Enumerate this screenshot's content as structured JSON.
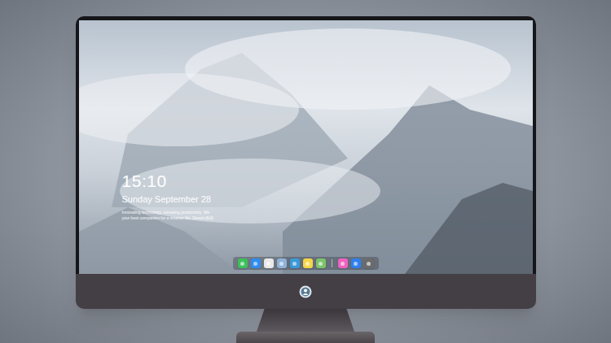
{
  "lock_screen": {
    "time": "15:10",
    "date": "Sunday September 28",
    "tagline": [
      "Innovating technology, elevating productivity. We",
      "your best companion for a smarter life. Deepin系统"
    ]
  },
  "dock": {
    "items": [
      {
        "kind": "app",
        "color": "#3cc15a"
      },
      {
        "kind": "app",
        "color": "#2f8df0"
      },
      {
        "kind": "app",
        "color": "#e9e9e9"
      },
      {
        "kind": "app",
        "color": "#8fb3d9"
      },
      {
        "kind": "app",
        "color": "#3a9ad9"
      },
      {
        "kind": "app",
        "color": "#f5d547"
      },
      {
        "kind": "app",
        "color": "#7cc36b"
      },
      {
        "kind": "separator"
      },
      {
        "kind": "app",
        "color": "#f062c0"
      },
      {
        "kind": "app",
        "color": "#2f7ff0"
      },
      {
        "kind": "app",
        "color": "#6b6b6b"
      }
    ]
  }
}
